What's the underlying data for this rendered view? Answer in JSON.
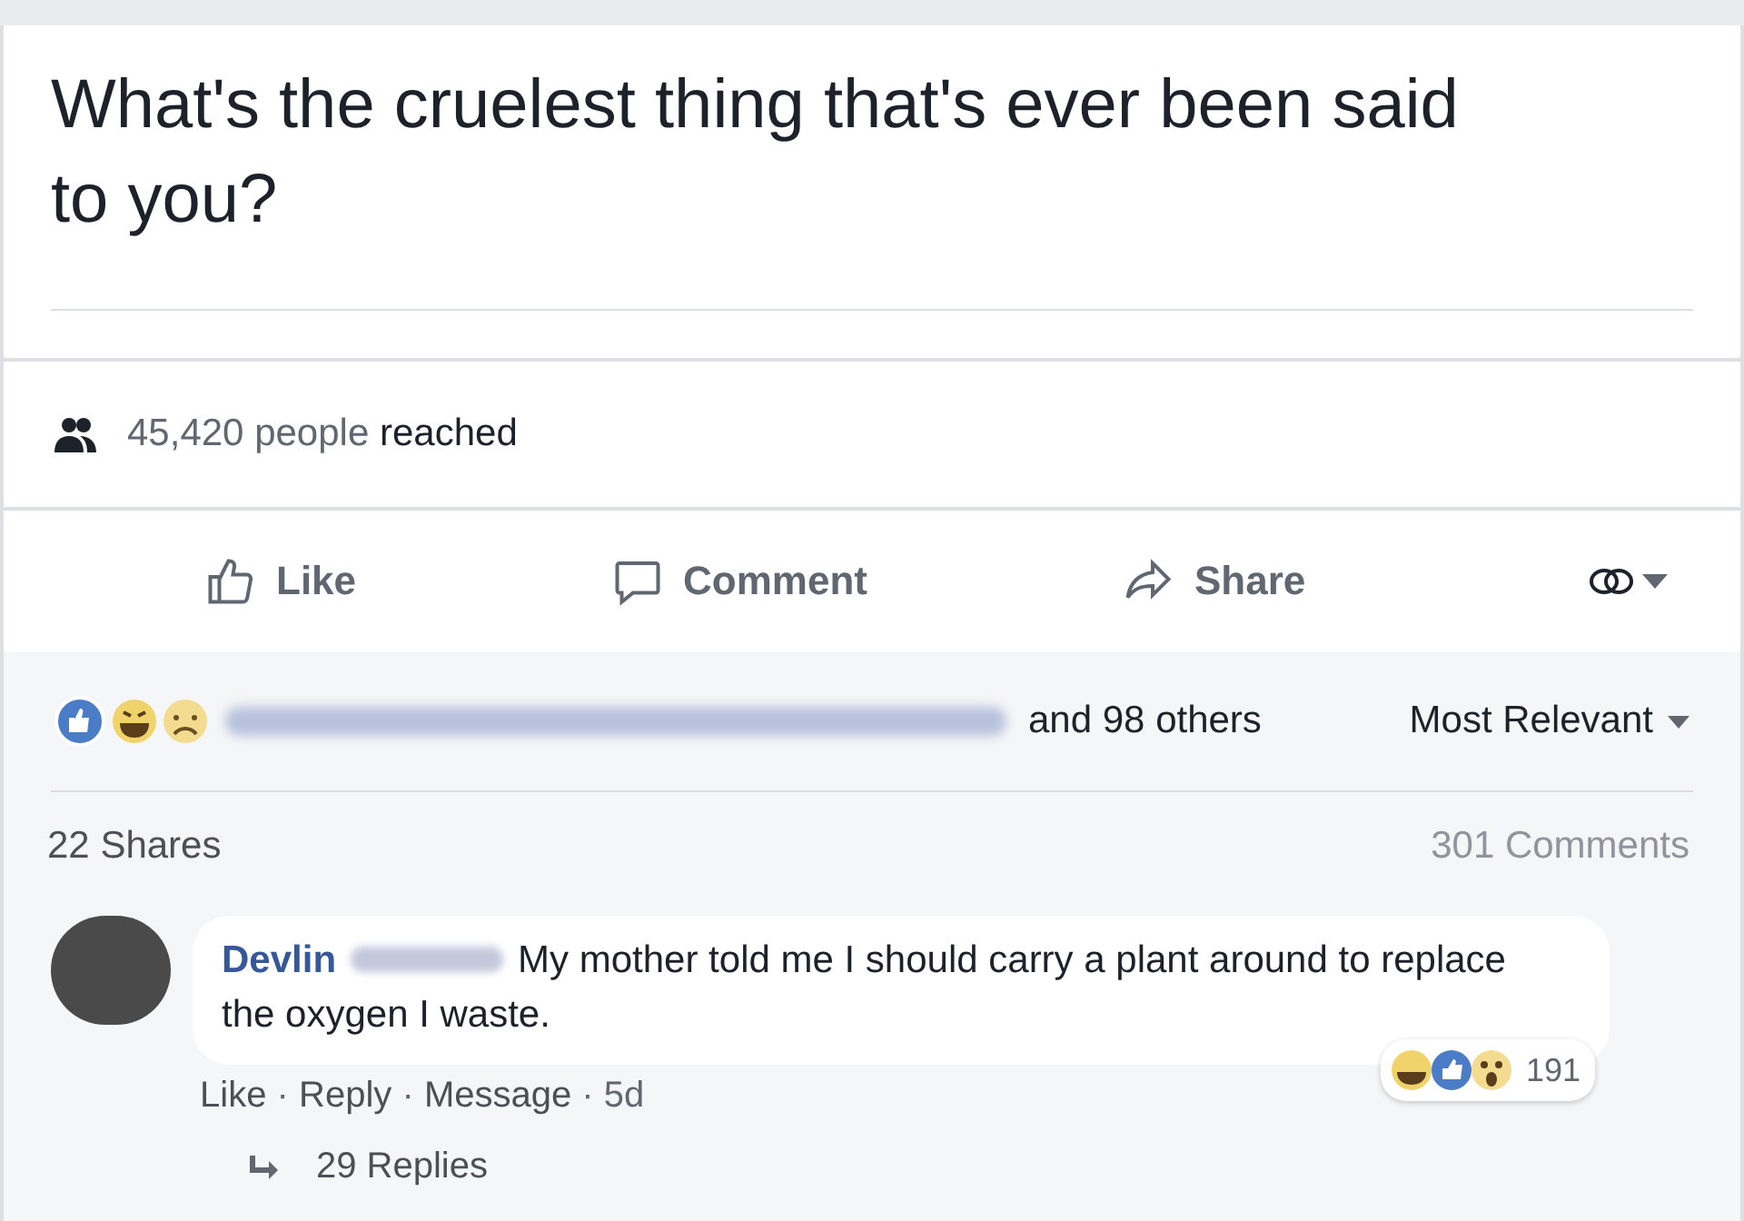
{
  "post": {
    "title": "What's the cruelest thing that's ever been said to you?",
    "reach_count": "45,420 people",
    "reach_label": "reached",
    "actions": [
      {
        "label": "Like",
        "kind": "like"
      },
      {
        "label": "Comment",
        "kind": "comment"
      },
      {
        "label": "Share",
        "kind": "share"
      }
    ]
  },
  "reactions": {
    "summary": "and 98 others",
    "sort": "Most Relevant"
  },
  "shares": "22 Shares",
  "comments_count": "301 Comments",
  "comment": {
    "author": "Devlin",
    "text": "My mother told me I should carry a plant around to replace the oxygen I waste.",
    "separator": "·",
    "actions": [
      "Like",
      "Reply",
      "Message"
    ],
    "time": "5d",
    "reaction_count": "191",
    "replies": "29 Replies"
  }
}
